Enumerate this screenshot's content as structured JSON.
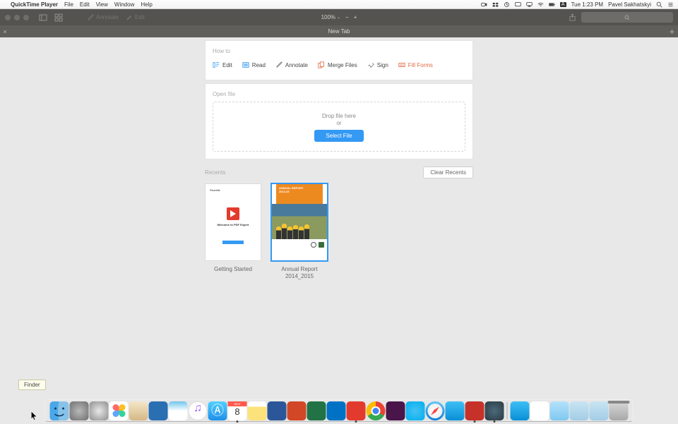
{
  "menubar": {
    "app_name": "QuickTime Player",
    "menus": [
      "File",
      "Edit",
      "View",
      "Window",
      "Help"
    ],
    "clock": "Tue 1:23 PM",
    "user": "Pavel Sakhatskyi"
  },
  "toolbar": {
    "annotate": "Annotate",
    "edit": "Edit",
    "zoom": "100%",
    "search_placeholder": ""
  },
  "tab": {
    "title": "New Tab"
  },
  "howto": {
    "section": "How to",
    "tabs": [
      {
        "label": "Edit"
      },
      {
        "label": "Read"
      },
      {
        "label": "Annotate"
      },
      {
        "label": "Merge Files"
      },
      {
        "label": "Sign"
      },
      {
        "label": "Fill Forms"
      }
    ]
  },
  "openfile": {
    "section": "Open file",
    "drop": "Drop file here",
    "or": "or",
    "button": "Select File"
  },
  "recents": {
    "section": "Recents",
    "clear": "Clear Recents",
    "items": [
      {
        "label": "Getting Started",
        "welcome": "Welcome to PDF Expert"
      },
      {
        "label": "Annual Report 2014_2015",
        "thumb_title": "ANNUAL REPORT",
        "thumb_sub": "2014.15"
      }
    ]
  },
  "tooltip": "Finder",
  "dock": {
    "items": [
      {
        "name": "finder",
        "bg": "linear-gradient(#66c3ee,#1e87e2)"
      },
      {
        "name": "settings",
        "bg": "radial-gradient(#b8b8b8,#6f6f6f)"
      },
      {
        "name": "launchpad",
        "bg": "radial-gradient(circle,#e8e8e8,#8d8d8d)"
      },
      {
        "name": "photos",
        "bg": "#fff"
      },
      {
        "name": "contacts",
        "bg": "linear-gradient(#f5e6c8,#d4b886)"
      },
      {
        "name": "trello",
        "bg": "#2b6fb3"
      },
      {
        "name": "preview",
        "bg": "linear-gradient(#6fc5ee,#fff 50%)"
      },
      {
        "name": "itunes",
        "bg": "#fff"
      },
      {
        "name": "appstore",
        "bg": "linear-gradient(#52cfff,#1e8fe8)"
      },
      {
        "name": "calendar",
        "bg": "#fff",
        "running": true
      },
      {
        "name": "notes",
        "bg": "linear-gradient(#fff 28%,#fbe27b 28%)"
      },
      {
        "name": "word",
        "bg": "#2b579a"
      },
      {
        "name": "powerpoint",
        "bg": "#d24726"
      },
      {
        "name": "excel",
        "bg": "#217346"
      },
      {
        "name": "outlook",
        "bg": "#0072c6"
      },
      {
        "name": "pdfexpert",
        "bg": "#e23b2e",
        "running": true
      },
      {
        "name": "chrome",
        "bg": "conic-gradient(#ea4335 0 33%,#34a853 0 66%,#fbbc05 0)"
      },
      {
        "name": "slack",
        "bg": "#4a154b"
      },
      {
        "name": "skype",
        "bg": "radial-gradient(#45c1f2,#00aff0)"
      },
      {
        "name": "safari",
        "bg": "linear-gradient(#60c6f7,#0f7cd8)"
      },
      {
        "name": "spark",
        "bg": "linear-gradient(#3dbff5,#0a8fd6)"
      },
      {
        "name": "pdf",
        "bg": "#c6312a",
        "running": true
      },
      {
        "name": "quicktime",
        "bg": "radial-gradient(#4a6a7a,#2b3a42)",
        "running": true
      }
    ],
    "right": [
      {
        "name": "spark2",
        "bg": "linear-gradient(#3dbff5,#0a8fd6)"
      },
      {
        "name": "skype-file",
        "bg": "#fff"
      },
      {
        "name": "folder",
        "bg": "linear-gradient(#b4e1fb,#7fc9f0)"
      },
      {
        "name": "desktop1",
        "bg": "linear-gradient(#c8e4f2,#a2cde6)"
      },
      {
        "name": "desktop2",
        "bg": "linear-gradient(#c8e4f2,#a2cde6)"
      },
      {
        "name": "trash",
        "bg": "radial-gradient(#e8e8e8,#b0b0b0)"
      }
    ]
  }
}
